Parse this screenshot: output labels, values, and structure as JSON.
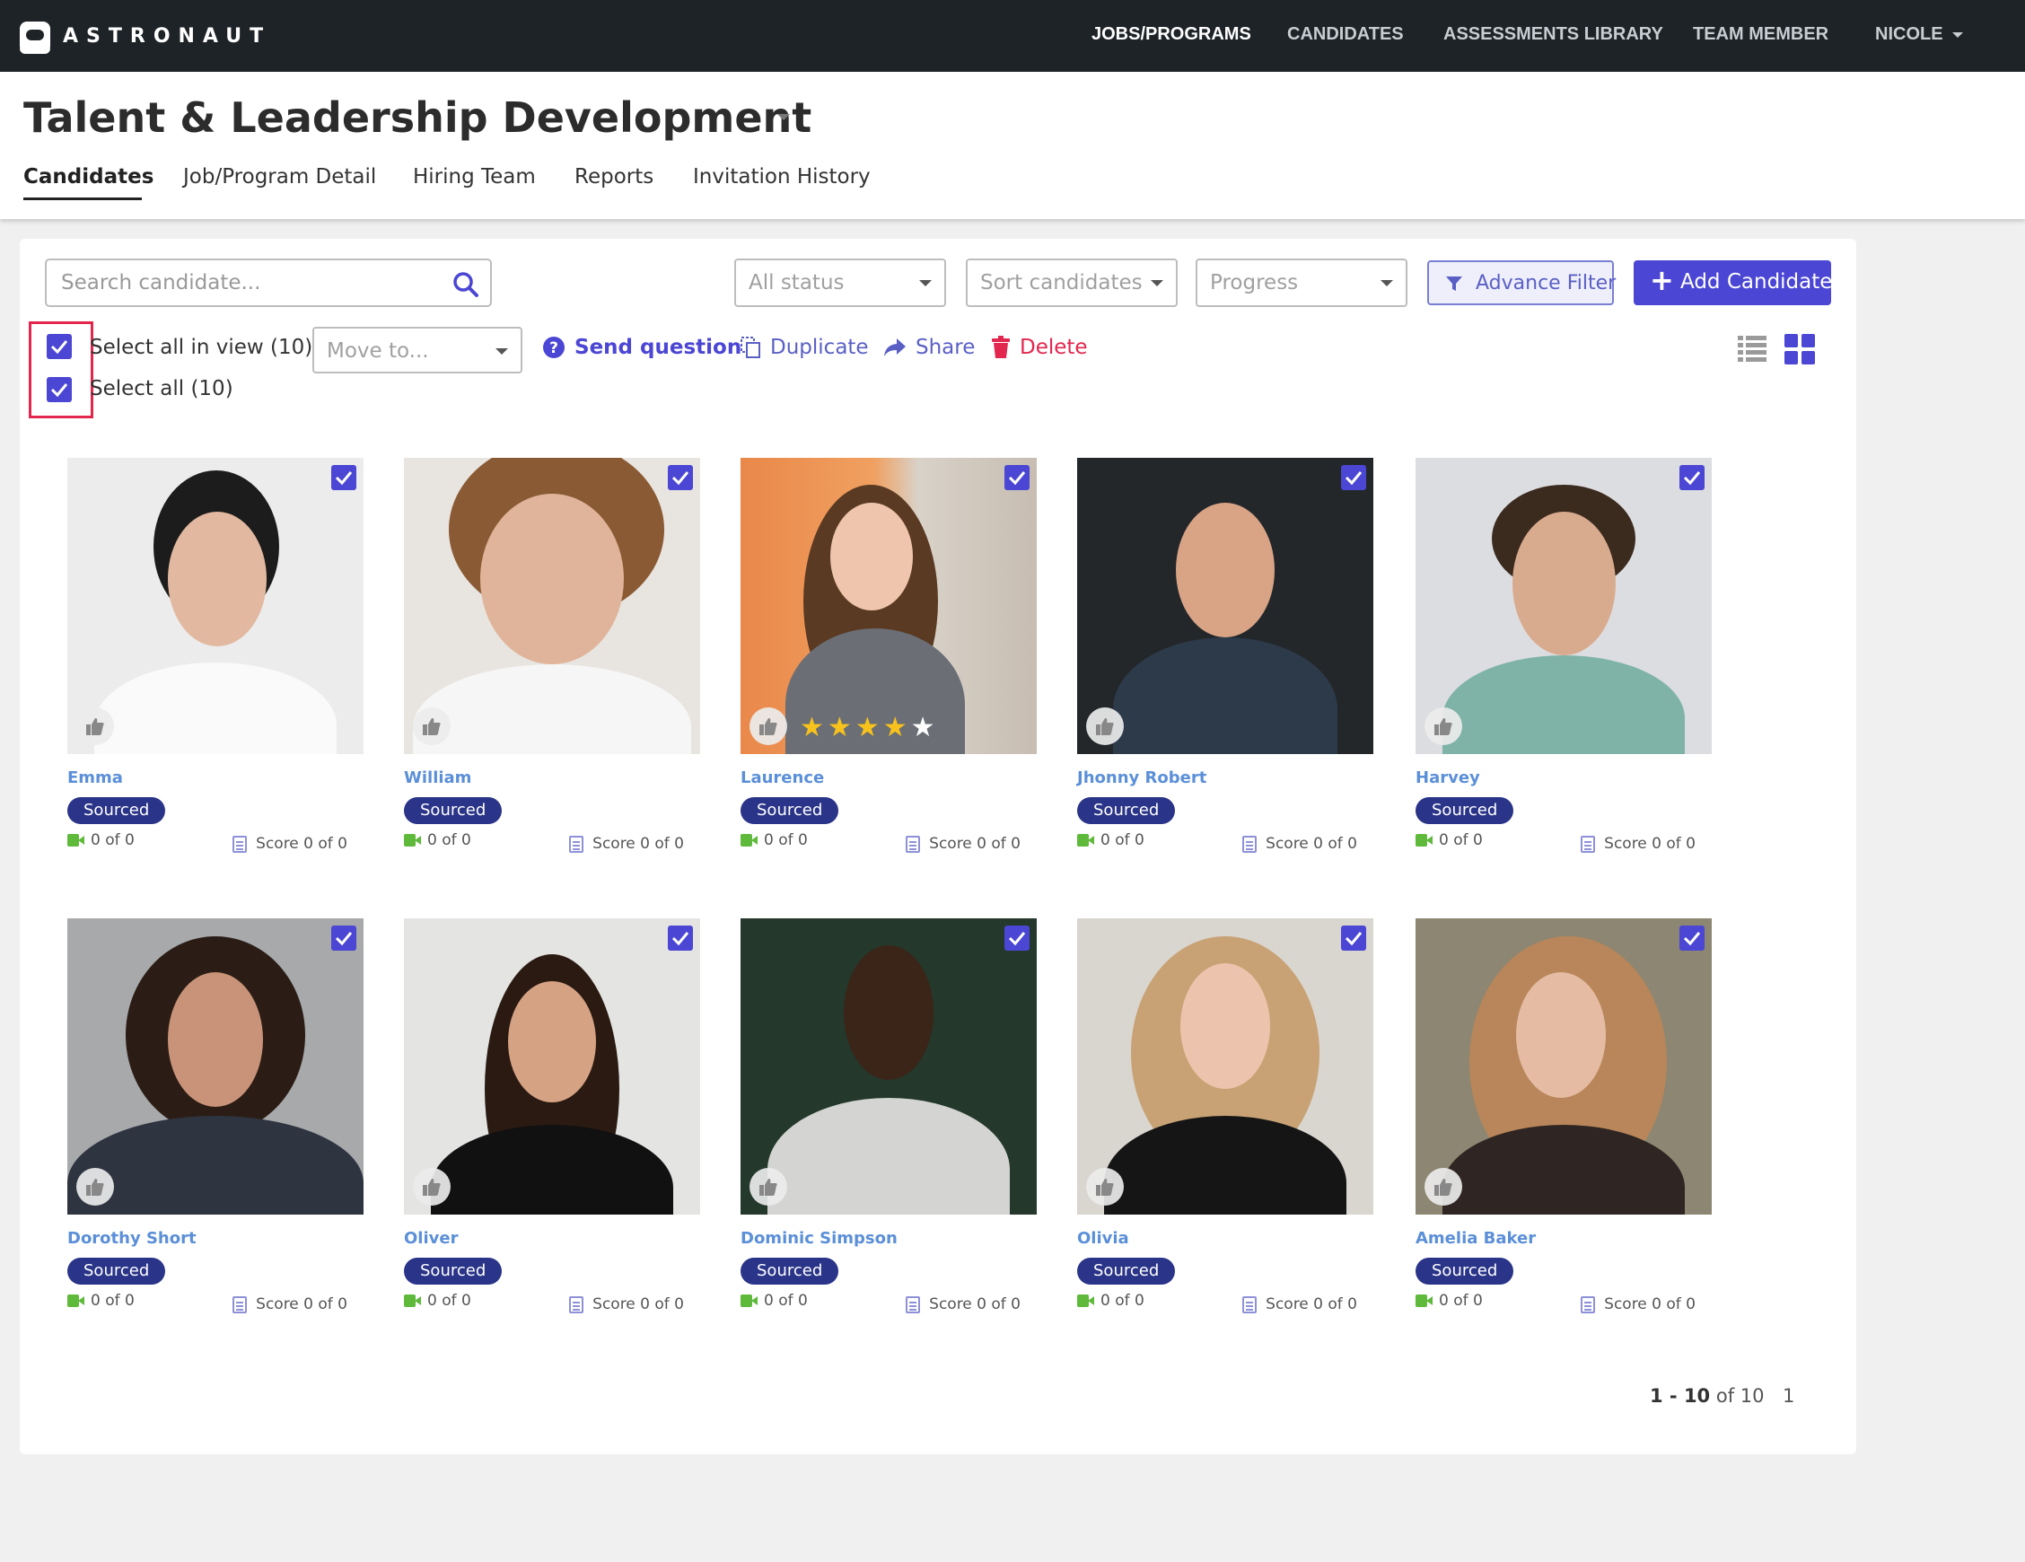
{
  "app": {
    "brand": "ASTRONAUT"
  },
  "nav": {
    "items": [
      {
        "label": "JOBS/PROGRAMS",
        "active": true
      },
      {
        "label": "CANDIDATES",
        "active": false
      },
      {
        "label": "ASSESSMENTS LIBRARY",
        "active": false
      },
      {
        "label": "TEAM MEMBER",
        "active": false
      }
    ],
    "user": "NICOLE"
  },
  "header": {
    "title": "Talent & Leadership Development",
    "tabs": [
      {
        "label": "Candidates",
        "active": true
      },
      {
        "label": "Job/Program Detail",
        "active": false
      },
      {
        "label": "Hiring Team",
        "active": false
      },
      {
        "label": "Reports",
        "active": false
      },
      {
        "label": "Invitation History",
        "active": false
      }
    ]
  },
  "toolbar": {
    "search_placeholder": "Search candidate...",
    "status_select": "All status",
    "sort_select": "Sort candidates",
    "progress_select": "Progress",
    "advance_filter": "Advance Filter",
    "add_candidate": "Add Candidate"
  },
  "selection": {
    "select_in_view": "Select all in view (10)",
    "select_all": "Select all (10)",
    "move_to": "Move to...",
    "send_question": "Send question",
    "duplicate": "Duplicate",
    "share": "Share",
    "delete": "Delete"
  },
  "colors": {
    "accent": "#4b46d4",
    "badge": "#2a3488",
    "name_link": "#5b8fd8",
    "danger": "#e3264d",
    "topbar": "#1e2328"
  },
  "candidates": [
    {
      "name": "Emma",
      "status": "Sourced",
      "videos": "0 of 0",
      "score": "Score 0 of 0",
      "rating": 0,
      "selected": true
    },
    {
      "name": "William",
      "status": "Sourced",
      "videos": "0 of 0",
      "score": "Score 0 of 0",
      "rating": 0,
      "selected": true
    },
    {
      "name": "Laurence",
      "status": "Sourced",
      "videos": "0 of 0",
      "score": "Score 0 of 0",
      "rating": 4,
      "selected": true
    },
    {
      "name": "Jhonny Robert",
      "status": "Sourced",
      "videos": "0 of 0",
      "score": "Score 0 of 0",
      "rating": 0,
      "selected": true
    },
    {
      "name": "Harvey",
      "status": "Sourced",
      "videos": "0 of 0",
      "score": "Score 0 of 0",
      "rating": 0,
      "selected": true
    },
    {
      "name": "Dorothy Short",
      "status": "Sourced",
      "videos": "0 of 0",
      "score": "Score 0 of 0",
      "rating": 0,
      "selected": true
    },
    {
      "name": "Oliver",
      "status": "Sourced",
      "videos": "0 of 0",
      "score": "Score 0 of 0",
      "rating": 0,
      "selected": true
    },
    {
      "name": "Dominic Simpson",
      "status": "Sourced",
      "videos": "0 of 0",
      "score": "Score 0 of 0",
      "rating": 0,
      "selected": true
    },
    {
      "name": "Olivia",
      "status": "Sourced",
      "videos": "0 of 0",
      "score": "Score 0 of 0",
      "rating": 0,
      "selected": true
    },
    {
      "name": "Amelia Baker",
      "status": "Sourced",
      "videos": "0 of 0",
      "score": "Score 0 of 0",
      "rating": 0,
      "selected": true
    }
  ],
  "pagination": {
    "range": "1 - 10",
    "of_total": "of 10",
    "page": "1"
  }
}
